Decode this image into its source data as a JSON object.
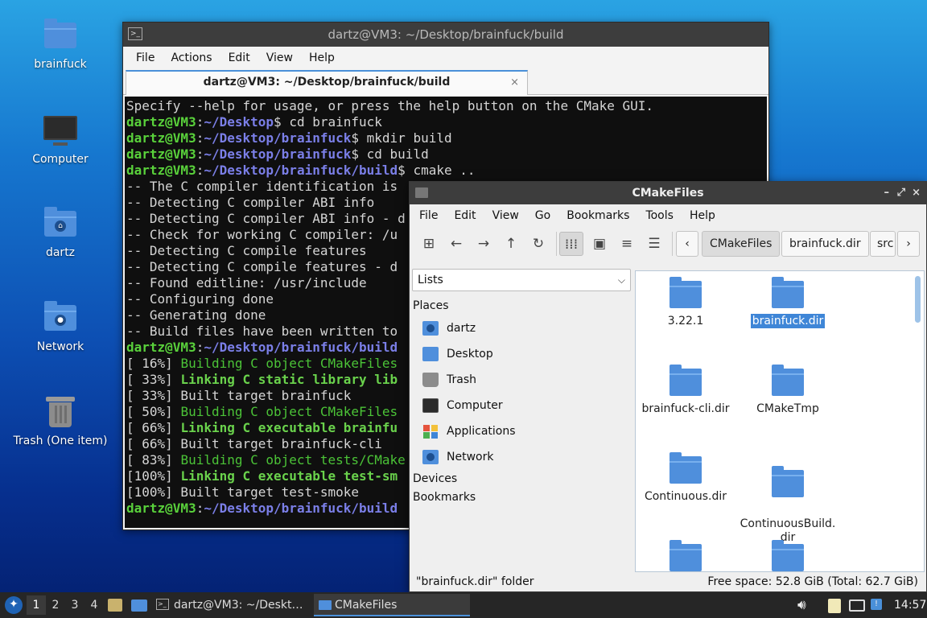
{
  "desktop": {
    "icons": [
      {
        "label": "brainfuck"
      },
      {
        "label": "Computer"
      },
      {
        "label": "dartz"
      },
      {
        "label": "Network"
      },
      {
        "label": "Trash (One item)"
      }
    ]
  },
  "terminal": {
    "title": "dartz@VM3: ~/Desktop/brainfuck/build",
    "menu": [
      "File",
      "Actions",
      "Edit",
      "View",
      "Help"
    ],
    "tab_label": "dartz@VM3: ~/Desktop/brainfuck/build",
    "tab_close": "×",
    "lines": [
      [
        [
          "",
          "Specify --help for usage, or press the help button on the CMake GUI."
        ]
      ],
      [
        [
          "g",
          "dartz@VM3"
        ],
        [
          "",
          ":"
        ],
        [
          "p",
          "~/Desktop"
        ],
        [
          "",
          "$ cd brainfuck"
        ]
      ],
      [
        [
          "g",
          "dartz@VM3"
        ],
        [
          "",
          ":"
        ],
        [
          "p",
          "~/Desktop/brainfuck"
        ],
        [
          "",
          "$ mkdir build"
        ]
      ],
      [
        [
          "g",
          "dartz@VM3"
        ],
        [
          "",
          ":"
        ],
        [
          "p",
          "~/Desktop/brainfuck"
        ],
        [
          "",
          "$ cd build"
        ]
      ],
      [
        [
          "g",
          "dartz@VM3"
        ],
        [
          "",
          ":"
        ],
        [
          "p",
          "~/Desktop/brainfuck/build"
        ],
        [
          "",
          "$ cmake .."
        ]
      ],
      [
        [
          "",
          "-- The C compiler identification is"
        ]
      ],
      [
        [
          "",
          "-- Detecting C compiler ABI info"
        ]
      ],
      [
        [
          "",
          "-- Detecting C compiler ABI info - d"
        ]
      ],
      [
        [
          "",
          "-- Check for working C compiler: /u"
        ]
      ],
      [
        [
          "",
          "-- Detecting C compile features"
        ]
      ],
      [
        [
          "",
          "-- Detecting C compile features - d"
        ]
      ],
      [
        [
          "",
          "-- Found editline: /usr/include"
        ]
      ],
      [
        [
          "",
          "-- Configuring done"
        ]
      ],
      [
        [
          "",
          "-- Generating done"
        ]
      ],
      [
        [
          "",
          "-- Build files have been written to"
        ]
      ],
      [
        [
          "g",
          "dartz@VM3"
        ],
        [
          "",
          ":"
        ],
        [
          "p",
          "~/Desktop/brainfuck/build"
        ]
      ],
      [
        [
          "",
          "[ 16%] "
        ],
        [
          "gn",
          "Building C object CMakeFiles"
        ]
      ],
      [
        [
          "",
          "[ 33%] "
        ],
        [
          "gb",
          "Linking C static library lib"
        ]
      ],
      [
        [
          "",
          "[ 33%] Built target brainfuck"
        ]
      ],
      [
        [
          "",
          "[ 50%] "
        ],
        [
          "gn",
          "Building C object CMakeFiles"
        ]
      ],
      [
        [
          "",
          "[ 66%] "
        ],
        [
          "gb",
          "Linking C executable brainfu"
        ]
      ],
      [
        [
          "",
          "[ 66%] Built target brainfuck-cli"
        ]
      ],
      [
        [
          "",
          "[ 83%] "
        ],
        [
          "gn",
          "Building C object tests/CMake"
        ]
      ],
      [
        [
          "",
          "[100%] "
        ],
        [
          "gb",
          "Linking C executable test-sm"
        ]
      ],
      [
        [
          "",
          "[100%] Built target test-smoke"
        ]
      ],
      [
        [
          "g",
          "dartz@VM3"
        ],
        [
          "",
          ":"
        ],
        [
          "p",
          "~/Desktop/brainfuck/build"
        ]
      ]
    ]
  },
  "filemanager": {
    "title": "CMakeFiles",
    "controls": [
      "–",
      "⤢",
      "×"
    ],
    "menu": [
      "File",
      "Edit",
      "View",
      "Go",
      "Bookmarks",
      "Tools",
      "Help"
    ],
    "toolbar_icons": [
      "new-tab-icon",
      "back-icon",
      "forward-icon",
      "up-icon",
      "reload-icon",
      "icon-view-icon",
      "thumbnail-view-icon",
      "compact-view-icon",
      "detailed-list-icon"
    ],
    "breadcrumbs": [
      "CMakeFiles",
      "brainfuck.dir",
      "src"
    ],
    "sidebar_mode": "Lists",
    "places_header": "Places",
    "places": [
      {
        "label": "dartz",
        "icon": "home-folder-icon"
      },
      {
        "label": "Desktop",
        "icon": "desktop-icon"
      },
      {
        "label": "Trash",
        "icon": "trash-icon"
      },
      {
        "label": "Computer",
        "icon": "computer-icon"
      },
      {
        "label": "Applications",
        "icon": "applications-icon"
      },
      {
        "label": "Network",
        "icon": "network-icon"
      }
    ],
    "devices_header": "Devices",
    "bookmarks_header": "Bookmarks",
    "items": [
      {
        "name": "3.22.1"
      },
      {
        "name": "brainfuck.dir",
        "selected": true
      },
      {
        "name": "brainfuck-cli.dir"
      },
      {
        "name": "CMakeTmp"
      },
      {
        "name": "Continuous.dir"
      },
      {
        "name": "ContinuousBuild.\ndir"
      },
      {
        "name": ""
      },
      {
        "name": ""
      }
    ],
    "status_left": "\"brainfuck.dir\" folder",
    "status_right": "Free space: 52.8 GiB (Total: 62.7 GiB)"
  },
  "taskbar": {
    "workspaces": [
      "1",
      "2",
      "3",
      "4"
    ],
    "tasks": [
      {
        "label": "dartz@VM3: ~/Deskt…"
      },
      {
        "label": "CMakeFiles"
      }
    ],
    "clock": "14:57"
  }
}
